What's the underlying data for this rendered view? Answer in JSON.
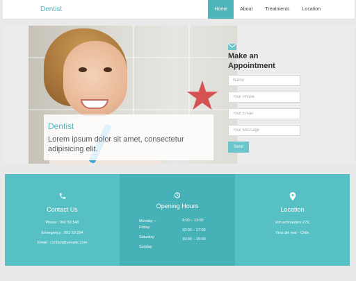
{
  "nav": {
    "brand": "Dentist",
    "links": [
      "Home",
      "About",
      "Treatments",
      "Location"
    ],
    "active_index": 0
  },
  "hero": {
    "caption_title": "Dentist",
    "caption_text": "Lorem ipsum dolor sit amet, consectetur adipisicing elit."
  },
  "form": {
    "icon": "mail-icon",
    "title": "Make an Appointment",
    "fields": {
      "name": "Name",
      "phone": "Your Phone",
      "email": "Your Email",
      "message": "Your Message"
    },
    "send_label": "Send"
  },
  "info": {
    "contact": {
      "icon": "phone-icon",
      "title": "Contact Us",
      "phone": "Phone : 992 50 540",
      "emergency": "Emergency : 991 50 294",
      "email": "Email : contact@youaite.com"
    },
    "hours": {
      "icon": "clock-icon",
      "title": "Opening Hours",
      "rows": [
        {
          "day": "Monday – Friday",
          "time": "9:00 – 13:00"
        },
        {
          "day": "",
          "time": "10:00 – 17:00"
        },
        {
          "day": "Saturday",
          "time": "10:00 – 15:00"
        },
        {
          "day": "Sunday",
          "time": ""
        }
      ]
    },
    "location": {
      "icon": "map-pin-icon",
      "title": "Location",
      "address1": "Von schroeders 279,",
      "address2": "Vina del mar - Chile"
    }
  },
  "colors": {
    "accent": "#4fb6bb",
    "strip_light": "#57c0c5",
    "strip_dark": "#46b1b6",
    "star": "#d23a3a"
  }
}
